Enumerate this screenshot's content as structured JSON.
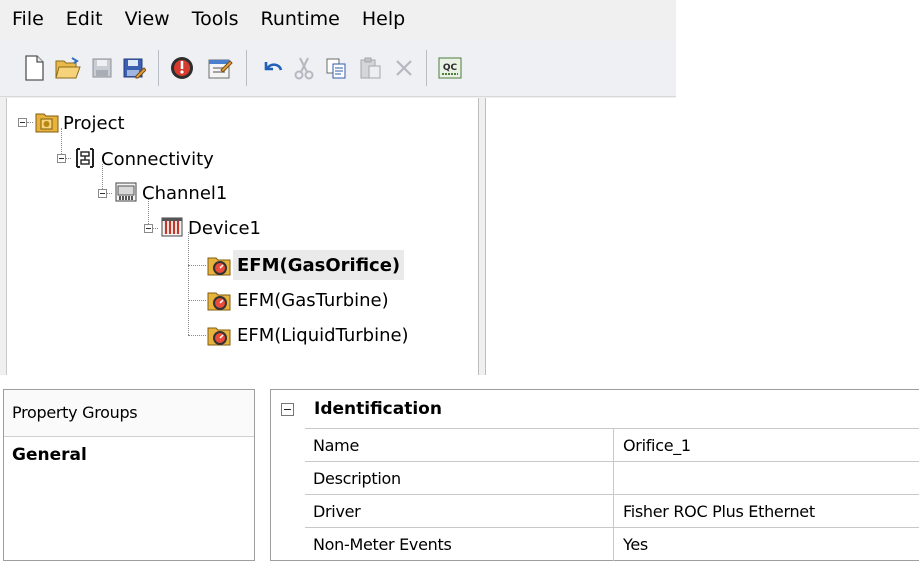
{
  "menu": [
    "File",
    "Edit",
    "View",
    "Tools",
    "Runtime",
    "Help"
  ],
  "toolbar": {
    "buttons": [
      {
        "name": "new-icon"
      },
      {
        "name": "open-folder-icon"
      },
      {
        "name": "save-icon"
      },
      {
        "name": "save-as-icon"
      },
      {
        "name": "runtime-connect-icon"
      },
      {
        "name": "properties-icon"
      },
      {
        "name": "undo-icon"
      },
      {
        "name": "cut-icon"
      },
      {
        "name": "copy-icon"
      },
      {
        "name": "paste-icon"
      },
      {
        "name": "delete-icon"
      },
      {
        "name": "quick-client-icon",
        "label": "QC"
      }
    ]
  },
  "tree": {
    "project": "Project",
    "connectivity": "Connectivity",
    "channel": "Channel1",
    "device": "Device1",
    "meters": [
      {
        "label": "EFM(GasOrifice)",
        "selected": true
      },
      {
        "label": "EFM(GasTurbine)",
        "selected": false
      },
      {
        "label": "EFM(LiquidTurbine)",
        "selected": false
      }
    ]
  },
  "property_groups": {
    "header": "Property Groups",
    "selected": "General"
  },
  "property_grid": {
    "section": "Identification",
    "rows": [
      {
        "name": "Name",
        "value": "Orifice_1"
      },
      {
        "name": "Description",
        "value": ""
      },
      {
        "name": "Driver",
        "value": "Fisher ROC Plus Ethernet"
      },
      {
        "name": "Non-Meter Events",
        "value": "Yes"
      }
    ]
  }
}
